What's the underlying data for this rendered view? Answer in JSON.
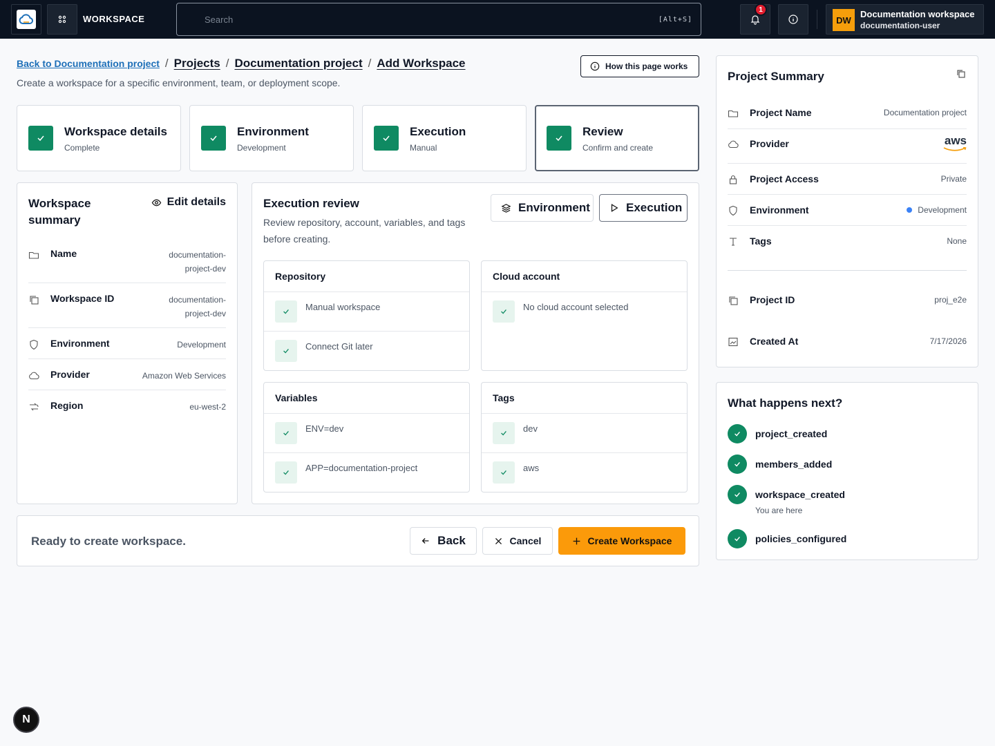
{
  "topbar": {
    "brand": "WORKSPACE",
    "search_placeholder": "Search",
    "search_shortcut": "[Alt+S]",
    "notification_count": "1",
    "user_initials": "DW",
    "user_workspace": "Documentation workspace",
    "user_name": "documentation-user"
  },
  "breadcrumb": {
    "back": "Back to Documentation project",
    "items": [
      "Projects",
      "Documentation project",
      "Add Workspace"
    ]
  },
  "page": {
    "subtitle": "Create a workspace for a specific environment, team, or deployment scope.",
    "how_button": "How this page works"
  },
  "steps": [
    {
      "title": "Workspace details",
      "sub": "Complete"
    },
    {
      "title": "Environment",
      "sub": "Development"
    },
    {
      "title": "Execution",
      "sub": "Manual"
    },
    {
      "title": "Review",
      "sub": "Confirm and create"
    }
  ],
  "workspace_summary": {
    "title": "Workspace summary",
    "edit": "Edit details",
    "rows": [
      {
        "label": "Name",
        "value": "documentation-\nproject-dev",
        "icon": "folder-icon"
      },
      {
        "label": "Workspace ID",
        "value": "documentation-\nproject-dev",
        "icon": "copy-icon"
      },
      {
        "label": "Environment",
        "value": "Development",
        "icon": "shield-icon"
      },
      {
        "label": "Provider",
        "value": "Amazon Web Services",
        "icon": "cloud-icon"
      },
      {
        "label": "Region",
        "value": "eu-west-2",
        "icon": "route-icon"
      }
    ]
  },
  "execution_review": {
    "title": "Execution review",
    "subtitle": "Review repository, account, variables, and tags before creating.",
    "tabs": [
      "Environment",
      "Execution"
    ],
    "panels": [
      {
        "title": "Repository",
        "items": [
          "Manual workspace",
          "Connect Git later"
        ]
      },
      {
        "title": "Cloud account",
        "items": [
          "No cloud account selected"
        ]
      },
      {
        "title": "Variables",
        "items": [
          "ENV=dev",
          "APP=documentation-project"
        ]
      },
      {
        "title": "Tags",
        "items": [
          "dev",
          "aws"
        ]
      }
    ]
  },
  "footer": {
    "status": "Ready to create workspace.",
    "back": "Back",
    "cancel": "Cancel",
    "create": "Create Workspace"
  },
  "project_summary": {
    "title": "Project Summary",
    "rows": [
      {
        "label": "Project Name",
        "value": "Documentation project"
      },
      {
        "label": "Provider",
        "value": "aws"
      },
      {
        "label": "Project Access",
        "value": "Private"
      },
      {
        "label": "Environment",
        "value": "Development"
      },
      {
        "label": "Tags",
        "value": "None"
      },
      {
        "label": "Project ID",
        "value": "proj_e2e"
      },
      {
        "label": "Created At",
        "value": "7/17/2026"
      }
    ]
  },
  "next_steps": {
    "title": "What happens next?",
    "items": [
      {
        "label": "project_created",
        "sub": ""
      },
      {
        "label": "members_added",
        "sub": ""
      },
      {
        "label": "workspace_created",
        "sub": "You are here"
      },
      {
        "label": "policies_configured",
        "sub": ""
      }
    ]
  },
  "floating_button": "N",
  "colors": {
    "topbar": "#0b1320",
    "success": "#0f8a62",
    "primary": "#fb9a0a",
    "link": "#1d6fb8",
    "badge": "#e11d2e"
  }
}
